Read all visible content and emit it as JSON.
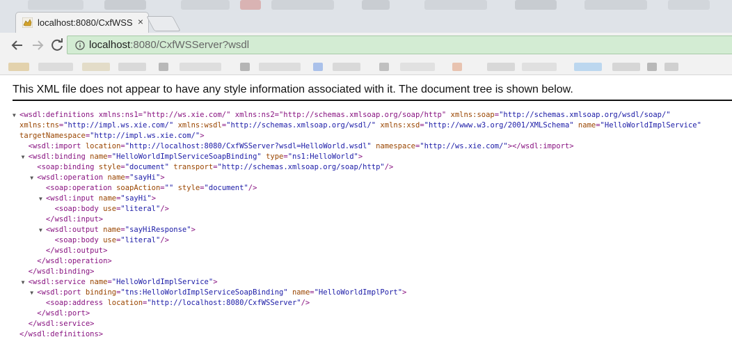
{
  "browser": {
    "tab": {
      "title": "localhost:8080/CxfWSS",
      "close_glyph": "×"
    },
    "address_bar": {
      "host": "localhost",
      "path": ":8080/CxfWSServer?wsdl"
    },
    "colors": {
      "secure_bar": "#d3ecd3",
      "tag": "#881280",
      "attr_name": "#994500",
      "attr_value": "#1a1aa6"
    }
  },
  "content": {
    "info_message": "This XML file does not appear to have any style information associated with it. The document tree is shown below.",
    "xml_lines": [
      {
        "t": "▼",
        "s": "<wsdl:definitions xmlns:ns1=\"http://ws.xie.com/\" xmlns:ns2=\"http://schemas.xmlsoap.org/soap/http\" xmlns:soap=\"http://schemas.xmlsoap.org/wsdl/soap/\""
      },
      {
        "t": "",
        "s": "xmlns:tns=\"http://impl.ws.xie.com/\" xmlns:wsdl=\"http://schemas.xmlsoap.org/wsdl/\" xmlns:xsd=\"http://www.w3.org/2001/XMLSchema\" name=\"HelloWorldImplService\""
      },
      {
        "t": "",
        "s": "targetNamespace=\"http://impl.ws.xie.com/\">"
      },
      {
        "t": "",
        "s": "  <wsdl:import location=\"http://localhost:8080/CxfWSServer?wsdl=HelloWorld.wsdl\" namespace=\"http://ws.xie.com/\"></wsdl:import>"
      },
      {
        "t": "▼",
        "s": "<wsdl:binding name=\"HelloWorldImplServiceSoapBinding\" type=\"ns1:HelloWorld\">",
        "i": 1
      },
      {
        "t": "",
        "s": "    <soap:binding style=\"document\" transport=\"http://schemas.xmlsoap.org/soap/http\"/>"
      },
      {
        "t": "▼",
        "s": "<wsdl:operation name=\"sayHi\">",
        "i": 2
      },
      {
        "t": "",
        "s": "      <soap:operation soapAction=\"\" style=\"document\"/>"
      },
      {
        "t": "▼",
        "s": "<wsdl:input name=\"sayHi\">",
        "i": 3
      },
      {
        "t": "",
        "s": "        <soap:body use=\"literal\"/>"
      },
      {
        "t": "",
        "s": "      </wsdl:input>"
      },
      {
        "t": "▼",
        "s": "<wsdl:output name=\"sayHiResponse\">",
        "i": 3
      },
      {
        "t": "",
        "s": "        <soap:body use=\"literal\"/>"
      },
      {
        "t": "",
        "s": "      </wsdl:output>"
      },
      {
        "t": "",
        "s": "    </wsdl:operation>"
      },
      {
        "t": "",
        "s": "  </wsdl:binding>"
      },
      {
        "t": "▼",
        "s": "<wsdl:service name=\"HelloWorldImplService\">",
        "i": 1
      },
      {
        "t": "▼",
        "s": "<wsdl:port binding=\"tns:HelloWorldImplServiceSoapBinding\" name=\"HelloWorldImplPort\">",
        "i": 2
      },
      {
        "t": "",
        "s": "      <soap:address location=\"http://localhost:8080/CxfWSServer\"/>"
      },
      {
        "t": "",
        "s": "    </wsdl:port>"
      },
      {
        "t": "",
        "s": "  </wsdl:service>"
      },
      {
        "t": "",
        "s": "</wsdl:definitions>"
      }
    ]
  }
}
